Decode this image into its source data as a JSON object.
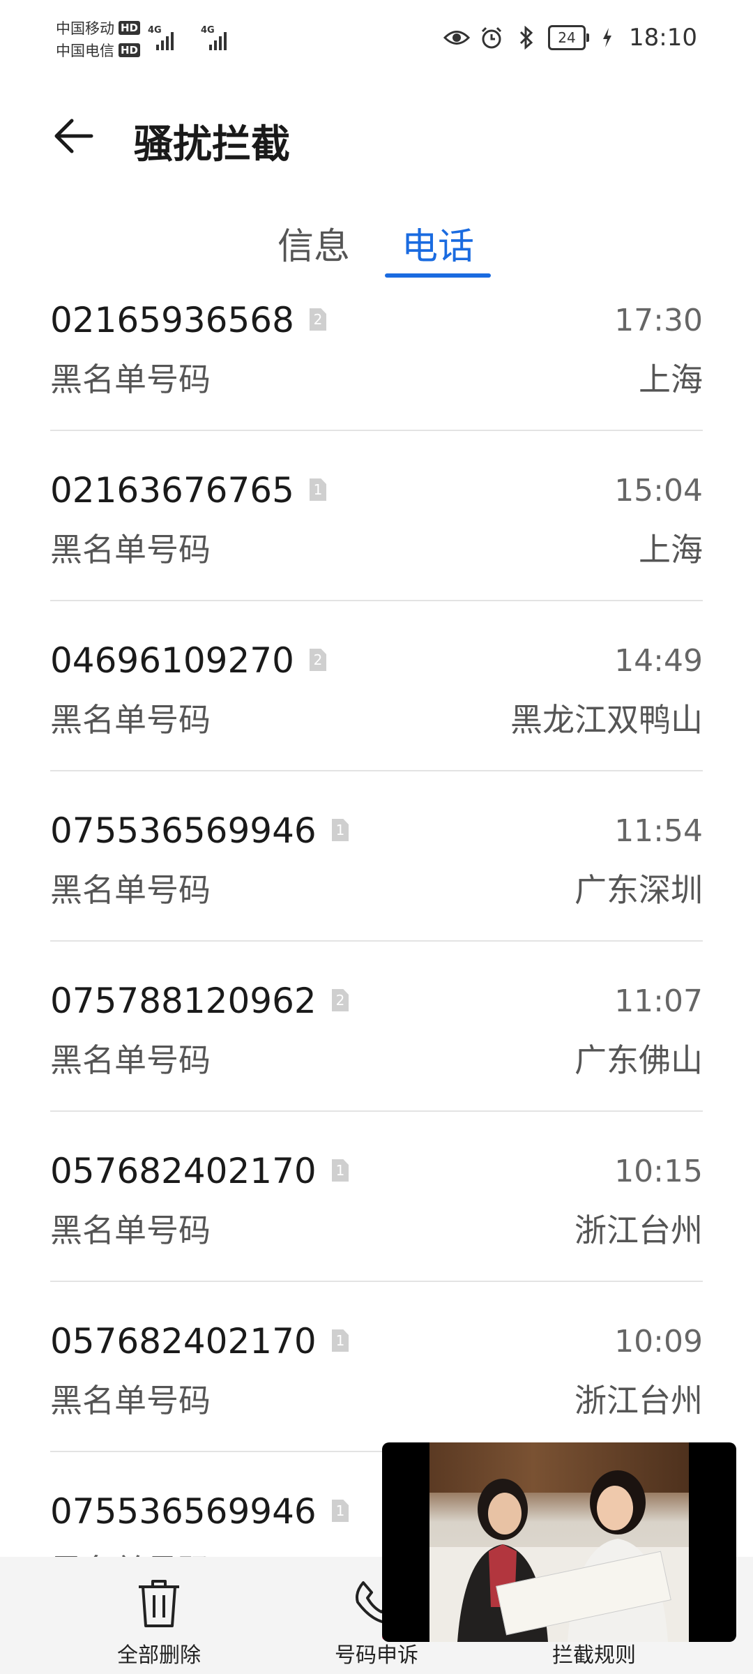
{
  "status_bar": {
    "carrier1": "中国移动",
    "carrier2": "中国电信",
    "hd": "HD",
    "network1": "4G",
    "network2": "4G",
    "battery": "24",
    "time": "18:10"
  },
  "header": {
    "title": "骚扰拦截"
  },
  "tabs": [
    {
      "label": "信息",
      "active": false
    },
    {
      "label": "电话",
      "active": true
    }
  ],
  "colors": {
    "accent": "#1a6be0",
    "sim_badge": "#cfcfcf",
    "divider": "#e3e3e3"
  },
  "calls": [
    {
      "number": "02165936568",
      "sim": "2",
      "tag": "黑名单号码",
      "time": "17:30",
      "location": "上海"
    },
    {
      "number": "02163676765",
      "sim": "1",
      "tag": "黑名单号码",
      "time": "15:04",
      "location": "上海"
    },
    {
      "number": "04696109270",
      "sim": "2",
      "tag": "黑名单号码",
      "time": "14:49",
      "location": "黑龙江双鸭山"
    },
    {
      "number": "075536569946",
      "sim": "1",
      "tag": "黑名单号码",
      "time": "11:54",
      "location": "广东深圳"
    },
    {
      "number": "075788120962",
      "sim": "2",
      "tag": "黑名单号码",
      "time": "11:07",
      "location": "广东佛山"
    },
    {
      "number": "057682402170",
      "sim": "1",
      "tag": "黑名单号码",
      "time": "10:15",
      "location": "浙江台州"
    },
    {
      "number": "057682402170",
      "sim": "1",
      "tag": "黑名单号码",
      "time": "10:09",
      "location": "浙江台州"
    },
    {
      "number": "075536569946",
      "sim": "1",
      "tag": "黑名单号码",
      "time": "",
      "location": ""
    }
  ],
  "bottom_bar": {
    "delete_all": "全部删除",
    "number_appeal": "号码申诉",
    "block_rules": "拦截规则",
    "delete_icon": "trash-icon",
    "appeal_icon": "phone-icon",
    "rules_icon": "rules-icon"
  }
}
